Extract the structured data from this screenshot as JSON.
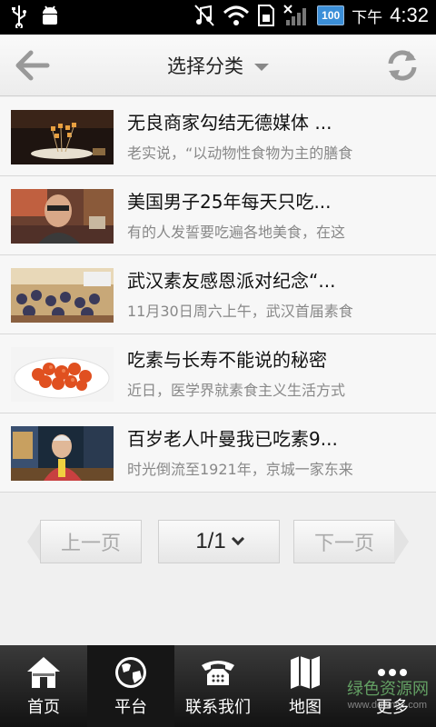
{
  "status": {
    "battery": "100",
    "ampm": "下午",
    "time": "4:32"
  },
  "header": {
    "title": "选择分类"
  },
  "articles": [
    {
      "title": "无良商家勾结无德媒体 ...",
      "desc": "老实说，“以动物性食物为主的膳食"
    },
    {
      "title": "美国男子25年每天只吃...",
      "desc": "有的人发誓要吃遍各地美食，在这"
    },
    {
      "title": "武汉素友感恩派对纪念“...",
      "desc": "11月30日周六上午，武汉首届素食"
    },
    {
      "title": "吃素与长寿不能说的秘密",
      "desc": "近日，医学界就素食主义生活方式"
    },
    {
      "title": "百岁老人叶曼我已吃素9...",
      "desc": "时光倒流至1921年，京城一家东来"
    }
  ],
  "pager": {
    "prev": "上一页",
    "page": "1/1",
    "next": "下一页"
  },
  "tabs": [
    {
      "label": "首页",
      "icon": "home-icon"
    },
    {
      "label": "平台",
      "icon": "globe-icon"
    },
    {
      "label": "联系我们",
      "icon": "phone-icon"
    },
    {
      "label": "地图",
      "icon": "map-icon"
    },
    {
      "label": "更多",
      "icon": "more-icon"
    }
  ],
  "watermark": {
    "text": "绿色资源网",
    "url": "www.downcc.com"
  }
}
